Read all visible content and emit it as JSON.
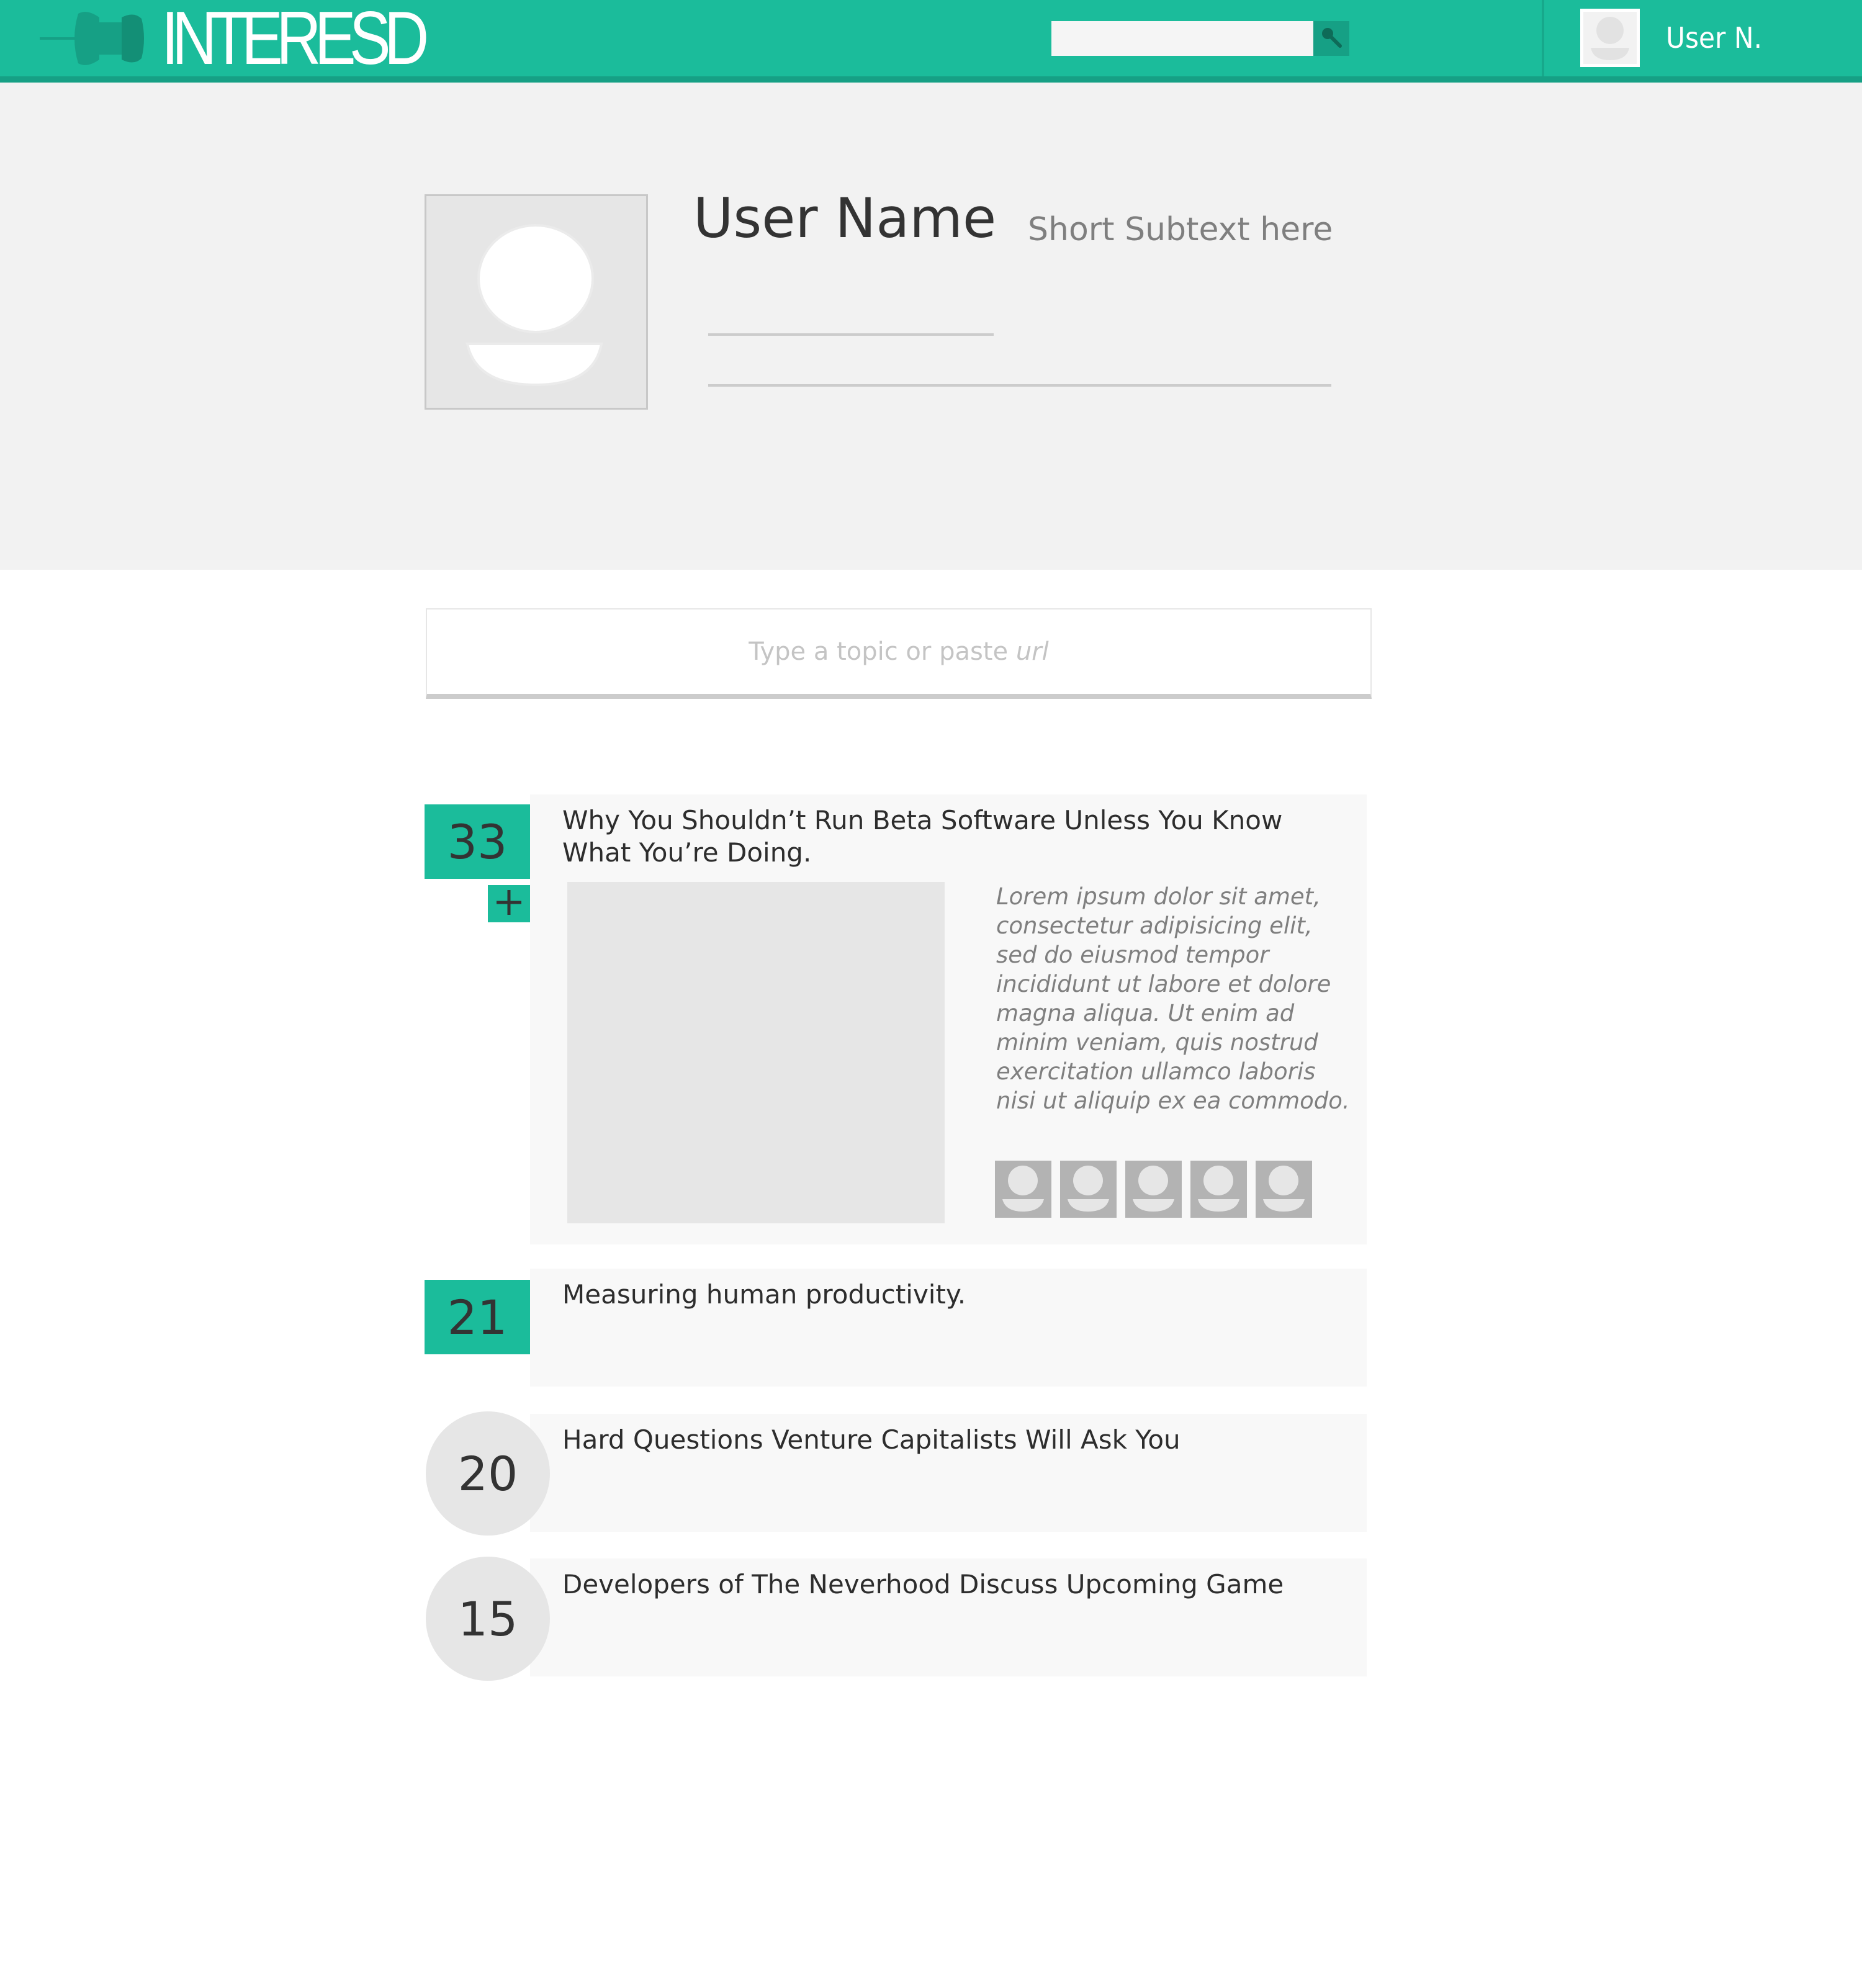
{
  "app": {
    "logo_text": "INTERESD",
    "colors": {
      "accent": "#1bbc9b",
      "accent_dark": "#16a085",
      "band": "#f2f2f2",
      "card": "#f8f8f8",
      "placeholder": "#e6e6e6"
    }
  },
  "header": {
    "search": {
      "placeholder": "",
      "value": "",
      "icon": "search-icon"
    },
    "user": {
      "short_name": "User N.",
      "icon": "avatar-icon"
    }
  },
  "profile": {
    "name": "User Name",
    "subtext": "Short Subtext here",
    "photo_icon": "user-silhouette-icon"
  },
  "composer": {
    "placeholder_prefix": "Type a topic or paste",
    "placeholder_emphasis": "url"
  },
  "feed": {
    "items": [
      {
        "score": "33",
        "title": "Why You Shouldn’t Run Beta Software Unless You Know What You’re Doing.",
        "excerpt": "Lorem ipsum dolor sit amet,\nconsectetur adipisicing elit,\nsed do eiusmod tempor\nincididunt ut labore et dolore\n magna aliqua. Ut enim ad\nminim veniam, quis nostrud\nexercitation ullamco laboris\nnisi ut aliquip ex ea commodo.",
        "add_icon": "plus-icon",
        "voter_count": 5
      },
      {
        "score": "21",
        "title": "Measuring human productivity."
      },
      {
        "score": "20",
        "title": "Hard Questions Venture Capitalists Will Ask You"
      },
      {
        "score": "15",
        "title": "Developers of The Neverhood Discuss Upcoming Game"
      }
    ]
  }
}
